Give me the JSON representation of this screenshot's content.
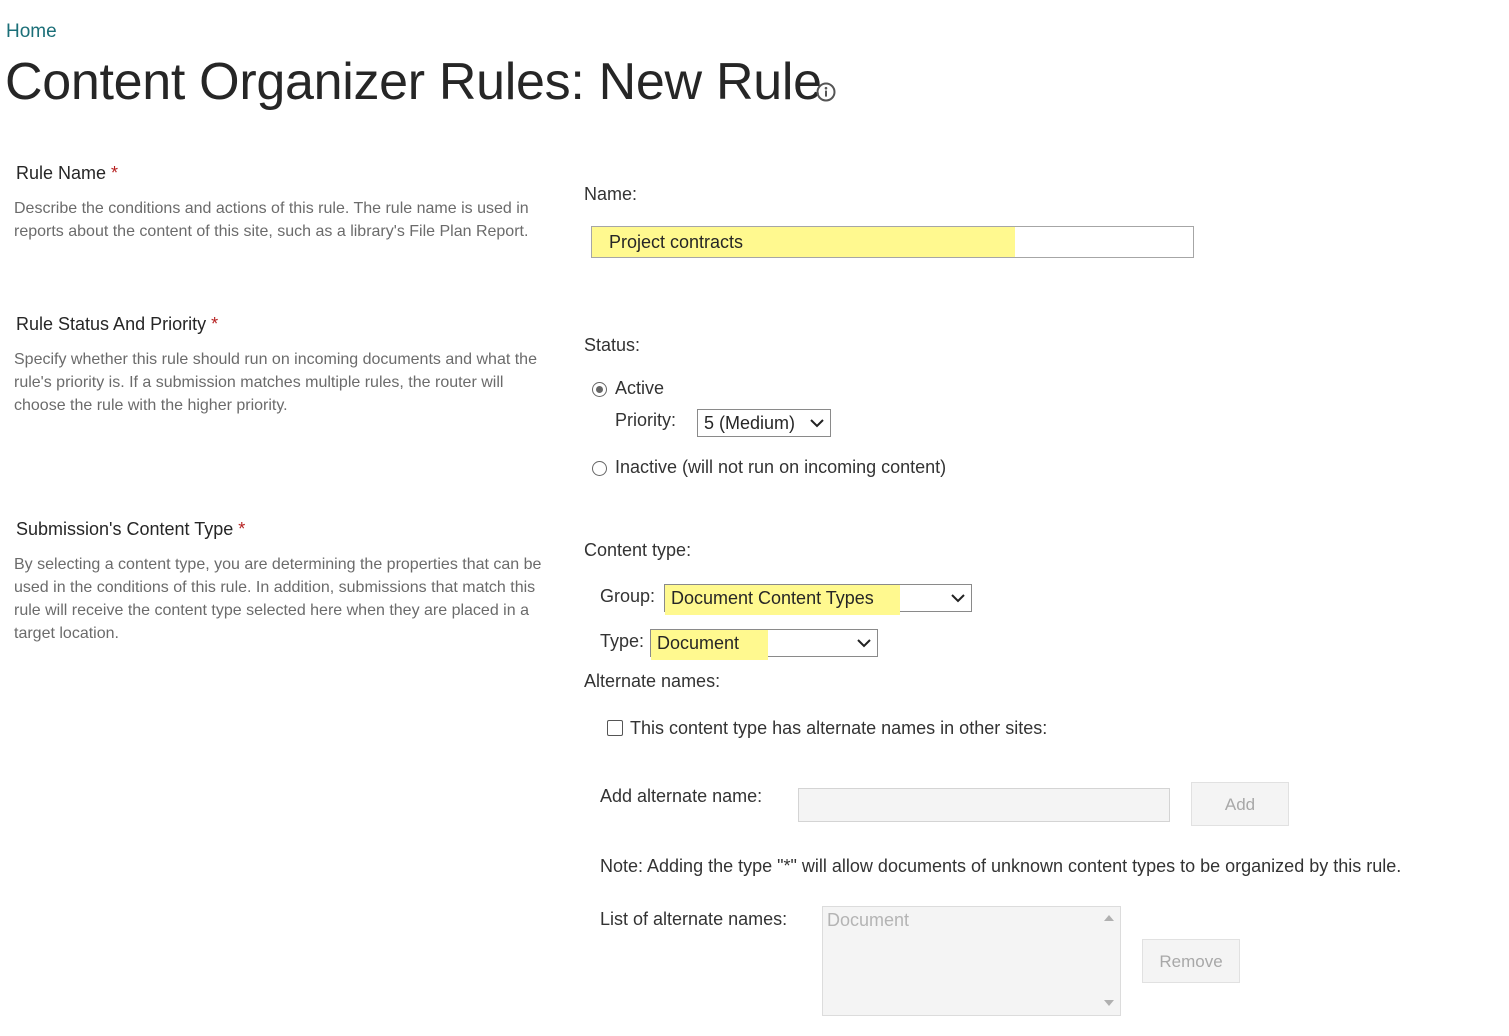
{
  "breadcrumb": {
    "home": "Home"
  },
  "page": {
    "title": "Content Organizer Rules: New Rule",
    "info_icon": "info-icon"
  },
  "sections": {
    "rule_name": {
      "title": "Rule Name",
      "required": "*",
      "description": "Describe the conditions and actions of this rule. The rule name is used in reports about the content of this site, such as a library's File Plan Report.",
      "field_label": "Name:",
      "value": "Project contracts"
    },
    "status_priority": {
      "title": "Rule Status And Priority",
      "required": "*",
      "description": "Specify whether this rule should run on incoming documents and what the rule's priority is. If a submission matches multiple rules, the router will choose the rule with the higher priority.",
      "field_label": "Status:",
      "active_label": "Active",
      "active_selected": true,
      "priority_label": "Priority:",
      "priority_value": "5 (Medium)",
      "inactive_label": "Inactive (will not run on incoming content)"
    },
    "content_type": {
      "title": "Submission's Content Type",
      "required": "*",
      "description": "By selecting a content type, you are determining the properties that can be used in the conditions of this rule. In addition, submissions that match this rule will receive the content type selected here when they are placed in a target location.",
      "field_label": "Content type:",
      "group_label": "Group:",
      "group_value": "Document Content Types",
      "type_label": "Type:",
      "type_value": "Document",
      "alternate_names_label": "Alternate names:",
      "alternate_checkbox_label": "This content type has alternate names in other sites:",
      "alternate_checked": false,
      "add_alternate_label": "Add alternate name:",
      "add_button": "Add",
      "note": "Note: Adding the type \"*\" will allow documents of unknown content types to be organized by this rule.",
      "list_label": "List of alternate names:",
      "list_items": [
        "Document"
      ],
      "remove_button": "Remove"
    }
  },
  "colors": {
    "highlight": "#fff98f",
    "link": "#1b6f78",
    "required": "#b62020"
  }
}
